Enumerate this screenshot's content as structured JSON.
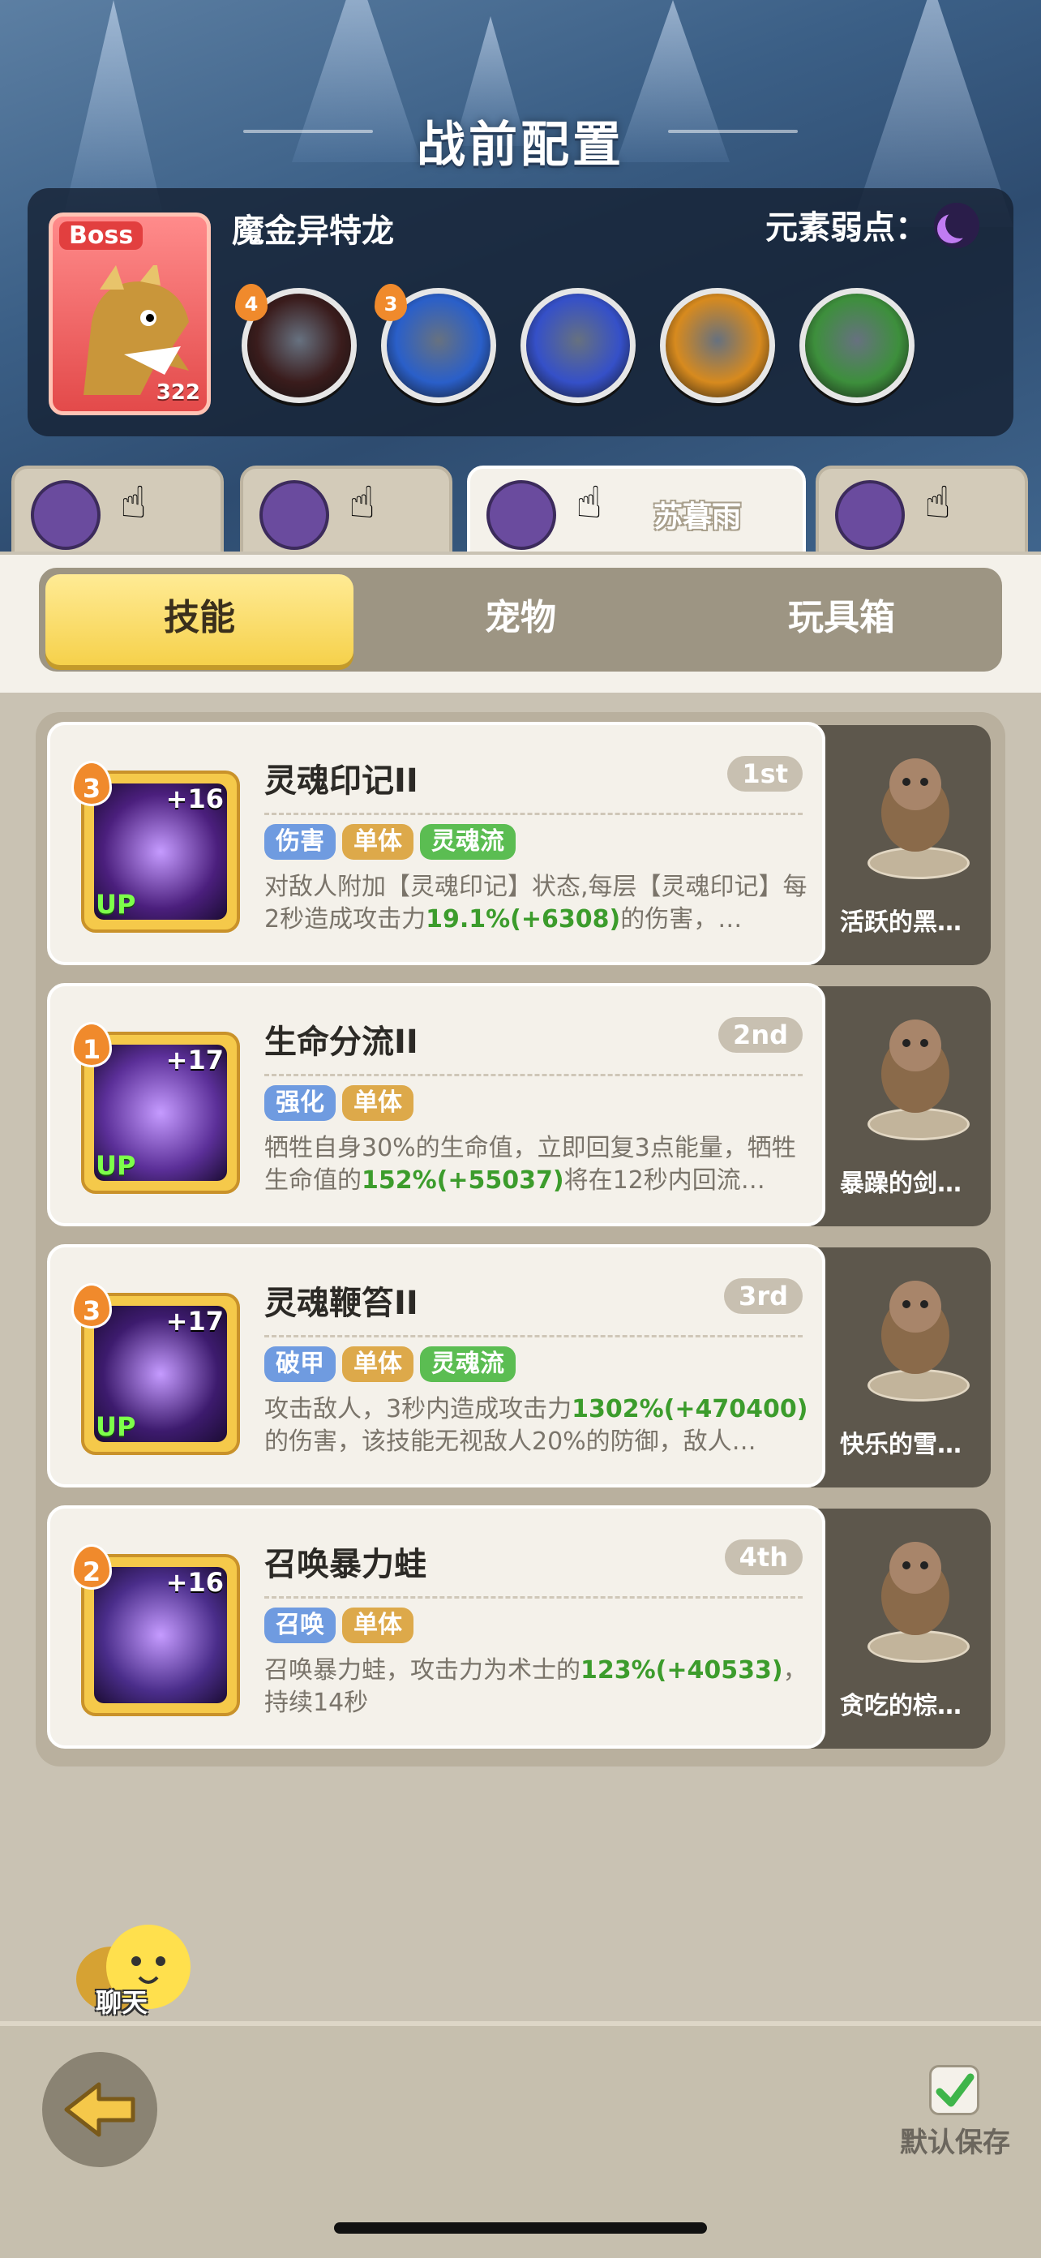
{
  "header": {
    "title": "战前配置"
  },
  "boss": {
    "tag": "Boss",
    "level": "322",
    "name": "魔金异特龙",
    "weakness_label": "元素弱点：",
    "weakness_icon": "moon-icon",
    "skills": [
      {
        "icon": "shark-jaw-icon",
        "badge": "4",
        "color": "#3a1c1c"
      },
      {
        "icon": "lightning-claw-icon",
        "badge": "3",
        "color": "#2a5fc9"
      },
      {
        "icon": "lightning-bolt-icon",
        "badge": "",
        "color": "#3550c8"
      },
      {
        "icon": "spiked-crown-icon",
        "badge": "",
        "color": "#d78a1e"
      },
      {
        "icon": "slime-icon",
        "badge": "",
        "color": "#3d8f3c"
      }
    ]
  },
  "heroes": [
    {
      "name": "",
      "active": false
    },
    {
      "name": "",
      "active": false
    },
    {
      "name": "苏暮雨",
      "active": true
    },
    {
      "name": "",
      "active": false
    }
  ],
  "tabs": [
    {
      "label": "技能",
      "active": true
    },
    {
      "label": "宠物",
      "active": false
    },
    {
      "label": "玩具箱",
      "active": false
    }
  ],
  "skills": [
    {
      "name": "灵魂印记II",
      "rank": "1st",
      "level": "3",
      "plus": "+16",
      "up": "UP",
      "icon": "soul-flame-icon",
      "icon_color": "#4b1f7d",
      "tags": [
        {
          "text": "伤害",
          "color": "blue"
        },
        {
          "text": "单体",
          "color": "gold"
        },
        {
          "text": "灵魂流",
          "color": "green"
        }
      ],
      "desc_parts": [
        "对敌人附加【灵魂印记】状态,每层【灵魂印记】每2秒造成攻击力",
        "19.1%(+6308)",
        "的伤害，…"
      ],
      "pet": {
        "name": "活跃的黑…",
        "icon": "boar-pet-icon"
      }
    },
    {
      "name": "生命分流II",
      "rank": "2nd",
      "level": "1",
      "plus": "+17",
      "up": "UP",
      "icon": "life-cross-icon",
      "icon_color": "#5b2f98",
      "tags": [
        {
          "text": "强化",
          "color": "blue"
        },
        {
          "text": "单体",
          "color": "gold"
        }
      ],
      "desc_parts": [
        "牺牲自身30%的生命值，立即回复3点能量，牺牲生命值的",
        "152%(+55037)",
        "将在12秒内回流…"
      ],
      "pet": {
        "name": "暴躁的剑…",
        "icon": "cat-pet-icon"
      }
    },
    {
      "name": "灵魂鞭笞II",
      "rank": "3rd",
      "level": "3",
      "plus": "+17",
      "up": "UP",
      "icon": "soul-whip-icon",
      "icon_color": "#3d1b6e",
      "tags": [
        {
          "text": "破甲",
          "color": "blue"
        },
        {
          "text": "单体",
          "color": "gold"
        },
        {
          "text": "灵魂流",
          "color": "green"
        }
      ],
      "desc_parts": [
        "攻击敌人，3秒内造成攻击力",
        "1302%(+470400)",
        "的伤害，该技能无视敌人20%的防御，敌人…"
      ],
      "pet": {
        "name": "快乐的雪…",
        "icon": "dino-pet-icon"
      }
    },
    {
      "name": "召唤暴力蛙",
      "rank": "4th",
      "level": "2",
      "plus": "+16",
      "up": "",
      "icon": "frog-icon",
      "icon_color": "#4a2d8a",
      "tags": [
        {
          "text": "召唤",
          "color": "blue"
        },
        {
          "text": "单体",
          "color": "gold"
        }
      ],
      "desc_parts": [
        "召唤暴力蛙，攻击力为术士的",
        "123%(+40533)",
        "，持续14秒"
      ],
      "pet": {
        "name": "贪吃的棕…",
        "icon": "bee-bear-pet-icon"
      }
    }
  ],
  "chat": {
    "label": "聊天",
    "icon": "chat-blob-icon"
  },
  "footer": {
    "back_icon": "back-arrow-icon",
    "save_label": "默认保存",
    "save_checked": true
  }
}
